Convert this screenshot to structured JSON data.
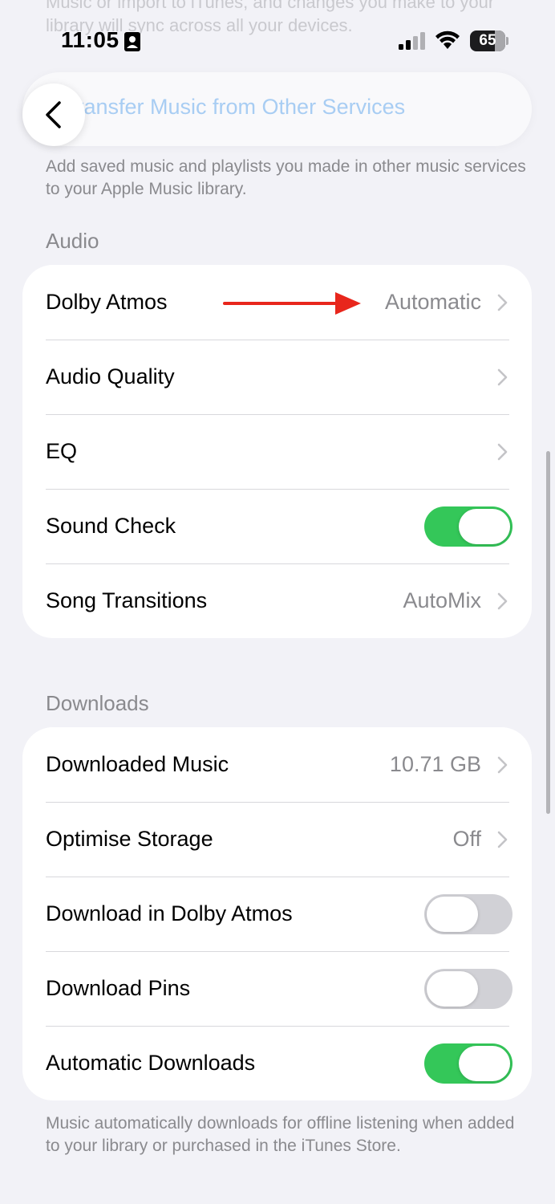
{
  "faded_top_text": "Music or import to iTunes, and changes you make to your library will sync across all your devices.",
  "status_bar": {
    "time": "11:05",
    "battery": "65"
  },
  "nav": {
    "back_icon": "chevron-left-icon",
    "title": "Transfer Music from Other Services"
  },
  "transfer_footer": "Add saved music and playlists you made in other music services to your Apple Music library.",
  "audio": {
    "header": "Audio",
    "rows": [
      {
        "label": "Dolby Atmos",
        "value": "Automatic",
        "type": "link"
      },
      {
        "label": "Audio Quality",
        "value": "",
        "type": "link"
      },
      {
        "label": "EQ",
        "value": "",
        "type": "link"
      },
      {
        "label": "Sound Check",
        "toggle": true,
        "type": "toggle"
      },
      {
        "label": "Song Transitions",
        "value": "AutoMix",
        "type": "link"
      }
    ]
  },
  "downloads": {
    "header": "Downloads",
    "rows": [
      {
        "label": "Downloaded Music",
        "value": "10.71 GB",
        "type": "link"
      },
      {
        "label": "Optimise Storage",
        "value": "Off",
        "type": "link"
      },
      {
        "label": "Download in Dolby Atmos",
        "toggle": false,
        "type": "toggle"
      },
      {
        "label": "Download Pins",
        "toggle": false,
        "type": "toggle"
      },
      {
        "label": "Automatic Downloads",
        "toggle": true,
        "type": "toggle"
      }
    ],
    "footer": "Music automatically downloads for offline listening when added to your library or purchased in the iTunes Store."
  },
  "colors": {
    "background": "#f2f2f7",
    "toggle_on": "#34c759",
    "toggle_off": "#d1d1d6",
    "annotation_arrow": "#e8261c",
    "accent_link": "#a8cdf3"
  }
}
